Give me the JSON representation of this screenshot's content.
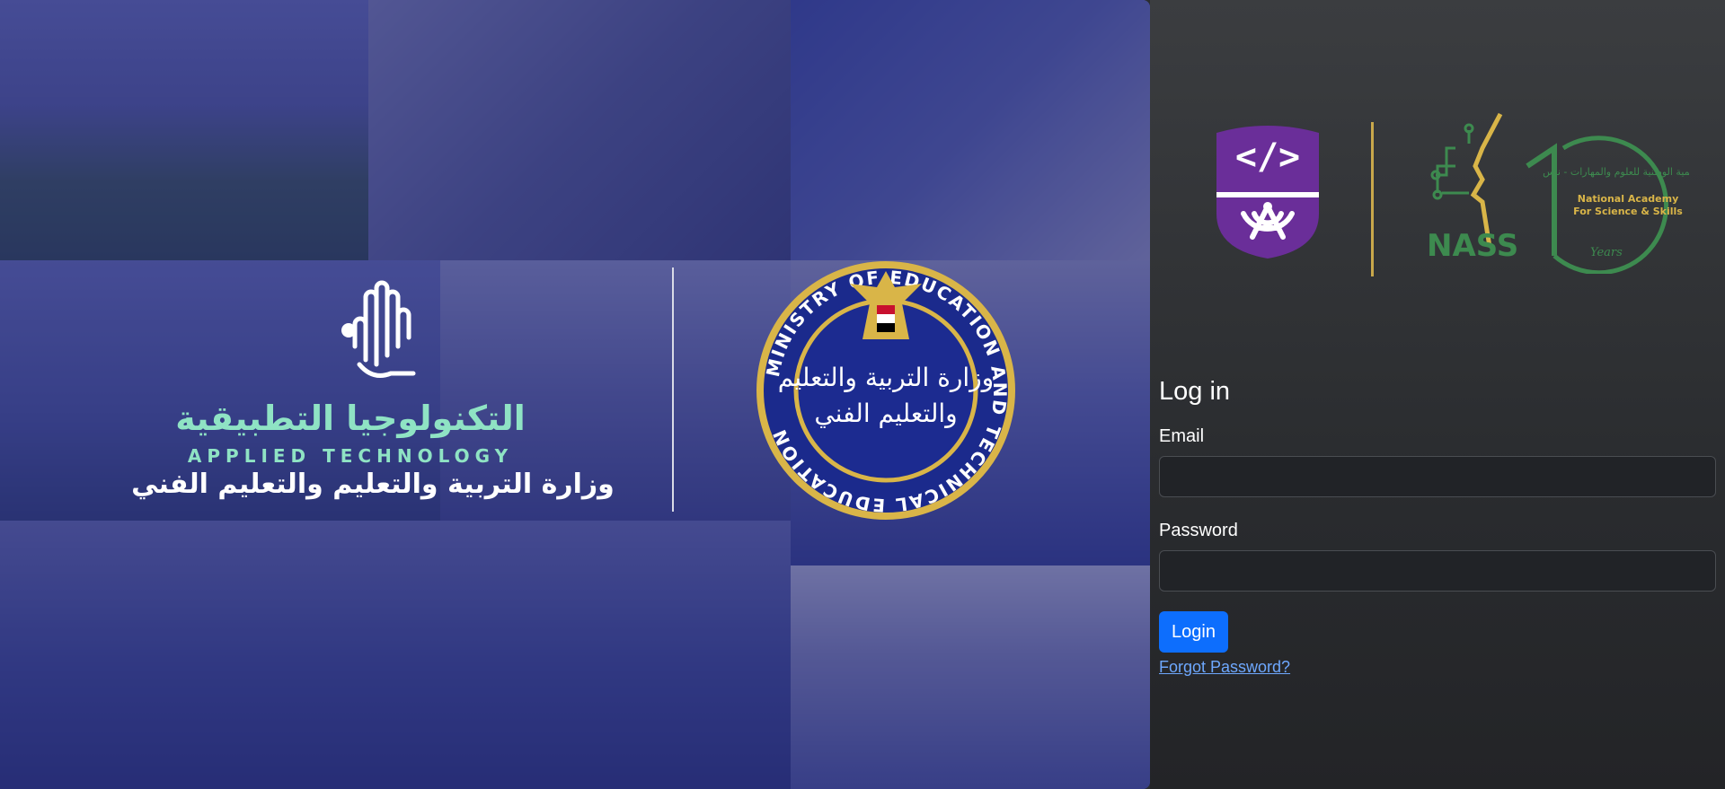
{
  "hero": {
    "applied_tech_arabic": "التكنولوجيا التطبيقية",
    "applied_tech_english": "APPLIED TECHNOLOGY",
    "ministry_arabic": "وزارة التربية والتعليم والتعليم الفني",
    "seal_text": "MINISTRY OF EDUCATION AND TECHNICAL EDUCATION",
    "seal_arabic_line1": "وزارة التربية والتعليم",
    "seal_arabic_line2": "والتعليم الفني"
  },
  "logos": {
    "code_symbol": "</>",
    "nass_name": "NASS",
    "nass_arabic": "الأكاديمية الوطنية للعلوم والمهارات - ناس",
    "nass_english_line1": "National Academy",
    "nass_english_line2": "For Science & Skills",
    "nass_years": "Years"
  },
  "login": {
    "title": "Log in",
    "email_label": "Email",
    "email_value": "",
    "password_label": "Password",
    "password_value": "",
    "login_button": "Login",
    "forgot_password": "Forgot Password?"
  },
  "colors": {
    "accent": "#0d6efd",
    "link": "#6ea8fe",
    "gold": "#c9a84b",
    "teal": "#8fe3c4",
    "purple": "#6a2e99",
    "nass_green": "#3d8a4f"
  }
}
